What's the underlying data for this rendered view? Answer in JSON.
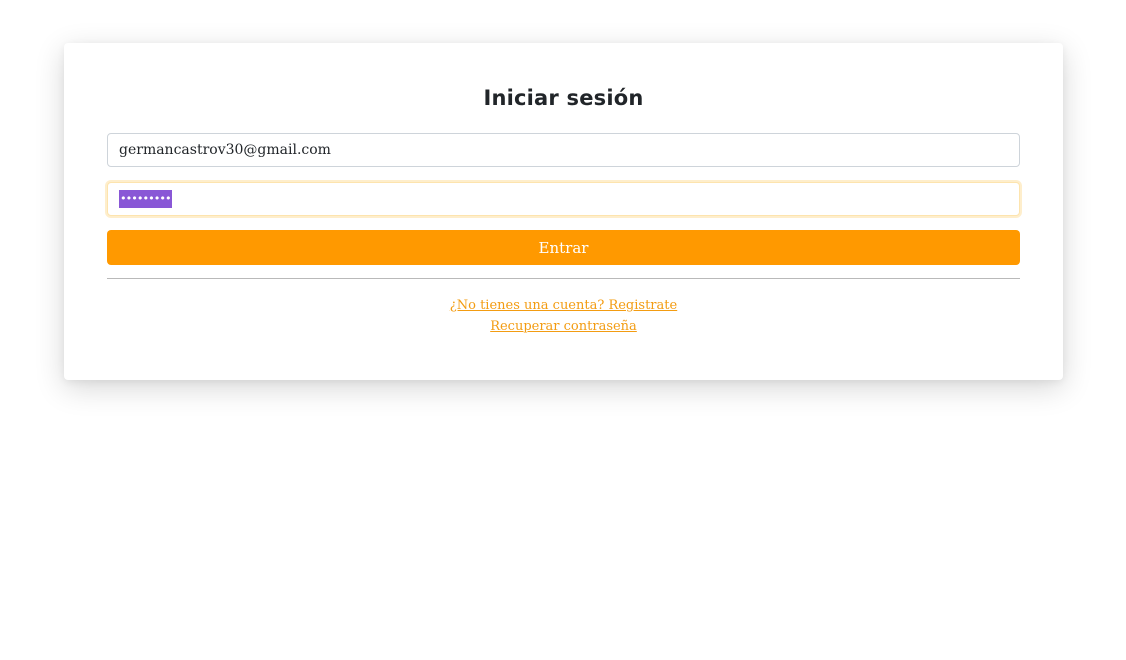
{
  "login": {
    "title": "Iniciar sesión",
    "email_value": "germancastrov30@gmail.com",
    "password_masked": "•••••••••",
    "submit_label": "Entrar",
    "register_link": "¿No tienes una cuenta? Registrate",
    "recover_link": "Recuperar contraseña"
  },
  "colors": {
    "accent": "#ff9900",
    "link": "#f39c12",
    "selection": "#8957d6",
    "title": "#212529"
  }
}
